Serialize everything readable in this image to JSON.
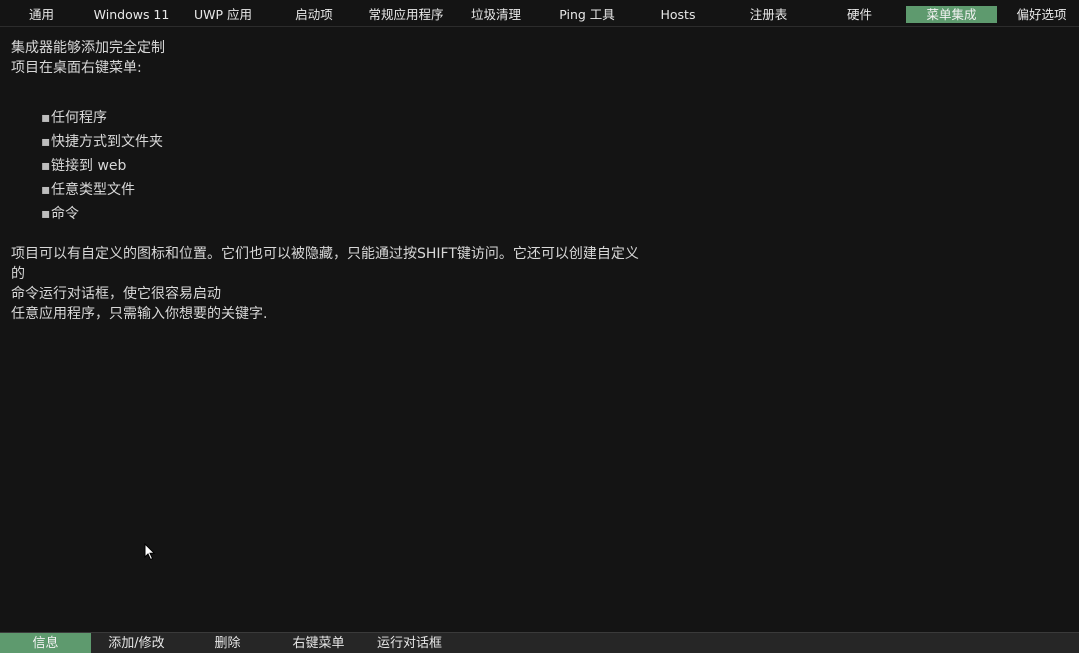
{
  "top_tabs": [
    {
      "label": "通用"
    },
    {
      "label": "Windows 11"
    },
    {
      "label": "UWP 应用"
    },
    {
      "label": "启动项"
    },
    {
      "label": "常规应用程序"
    },
    {
      "label": "垃圾清理"
    },
    {
      "label": "Ping 工具"
    },
    {
      "label": "Hosts"
    },
    {
      "label": "注册表"
    },
    {
      "label": "硬件"
    },
    {
      "label": "菜单集成"
    },
    {
      "label": "偏好选项"
    }
  ],
  "active_top_tab": "菜单集成",
  "content": {
    "intro_line1": "集成器能够添加完全定制",
    "intro_line2": "项目在桌面右键菜单:",
    "items": [
      "任何程序",
      "快捷方式到文件夹",
      "链接到 web",
      "任意类型文件",
      "命令"
    ],
    "bullet": "▪",
    "para_line1": "项目可以有自定义的图标和位置。它们也可以被隐藏，只能通过按SHIFT键访问。它还可以创建自定义",
    "para_line2": "的",
    "para_line3": "命令运行对话框，使它很容易启动",
    "para_line4": "任意应用程序，只需输入你想要的关键字."
  },
  "bottom_tabs": [
    {
      "label": "信息"
    },
    {
      "label": "添加/修改"
    },
    {
      "label": "删除"
    },
    {
      "label": "右键菜单"
    },
    {
      "label": "运行对话框"
    }
  ],
  "active_bottom_tab": "信息",
  "colors": {
    "background": "#141414",
    "accent": "#5e9a6e",
    "text": "#d8d8d8",
    "bottom_bar": "#262626"
  }
}
